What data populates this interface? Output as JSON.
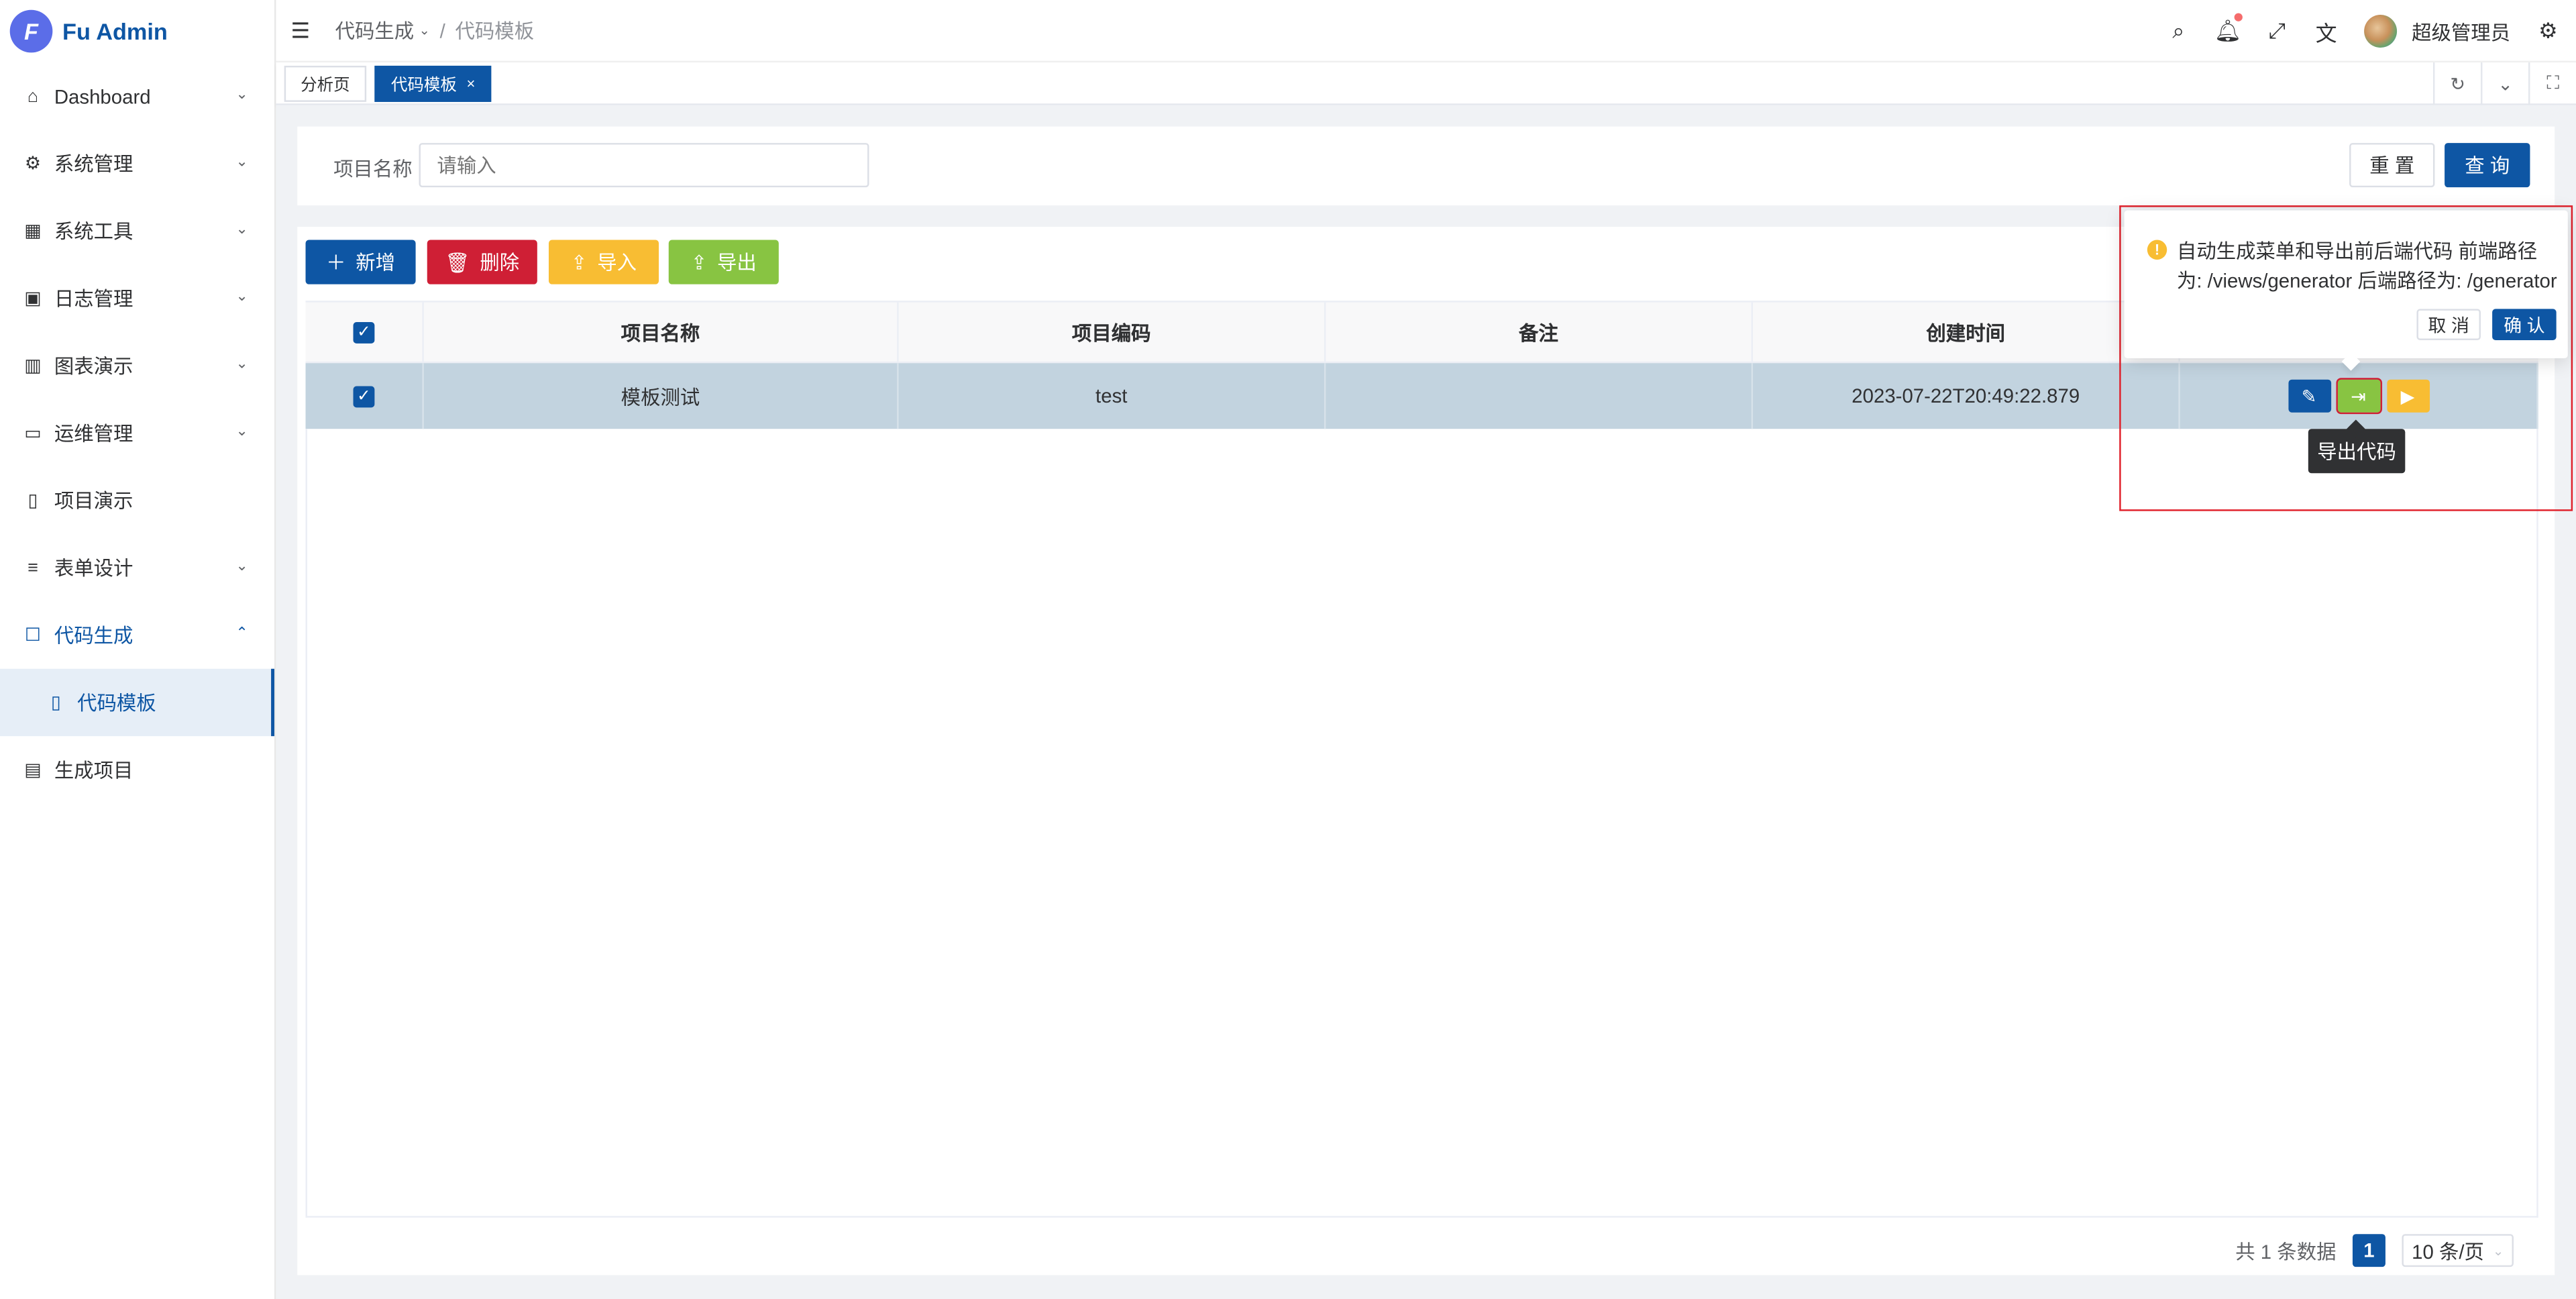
{
  "app": {
    "title": "Fu Admin",
    "logo_letter": "F"
  },
  "sidebar": {
    "items": [
      {
        "label": "Dashboard",
        "icon": "home-icon"
      },
      {
        "label": "系统管理",
        "icon": "gear-icon"
      },
      {
        "label": "系统工具",
        "icon": "grid-icon"
      },
      {
        "label": "日志管理",
        "icon": "terminal-icon"
      },
      {
        "label": "图表演示",
        "icon": "bar-chart-icon"
      },
      {
        "label": "运维管理",
        "icon": "monitor-icon"
      },
      {
        "label": "项目演示",
        "icon": "file-icon"
      },
      {
        "label": "表单设计",
        "icon": "list-icon"
      },
      {
        "label": "代码生成",
        "icon": "square-icon"
      },
      {
        "label": "代码模板",
        "icon": "document-icon"
      },
      {
        "label": "生成项目",
        "icon": "calendar-icon"
      }
    ]
  },
  "header": {
    "breadcrumb": [
      "代码生成",
      "代码模板"
    ],
    "separator": "/",
    "username": "超级管理员"
  },
  "tabs": [
    {
      "label": "分析页"
    },
    {
      "label": "代码模板",
      "close": "×"
    }
  ],
  "search": {
    "label": "项目名称",
    "placeholder": "请输入",
    "reset_label": "重 置",
    "query_label": "查 询"
  },
  "toolbar": {
    "add_label": "新增",
    "delete_label": "删除",
    "import_label": "导入",
    "export_label": "导出"
  },
  "table": {
    "columns": [
      "项目名称",
      "项目编码",
      "备注",
      "创建时间"
    ],
    "rows": [
      {
        "name": "模板测试",
        "code": "test",
        "remark": "",
        "created": "2023-07-22T20:49:22.879"
      }
    ]
  },
  "pagination": {
    "total_text": "共 1 条数据",
    "current_page": "1",
    "page_size": "10 条/页"
  },
  "popconfirm": {
    "message": "自动生成菜单和导出前后端代码 前端路径为: /views/generator 后端路径为: /generator",
    "cancel_label": "取 消",
    "confirm_label": "确 认"
  },
  "tooltip": {
    "text": "导出代码"
  },
  "colors": {
    "primary": "#0e56a4",
    "danger": "#cf1f35",
    "warning": "#f8bd33",
    "success": "#88c442"
  }
}
